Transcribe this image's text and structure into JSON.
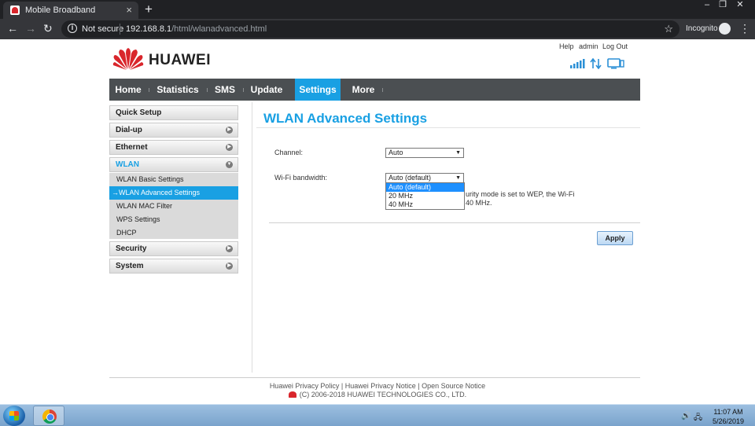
{
  "browser": {
    "tab_title": "Mobile Broadband",
    "tab_close": "×",
    "new_tab": "+",
    "not_secure": "Not secure",
    "url_host": "192.168.8.1",
    "url_path": "/html/wlanadvanced.html",
    "incognito": "Incognito",
    "win_minimize": "‒",
    "win_restore": "❐",
    "win_close": "✕"
  },
  "header": {
    "brand": "HUAWEI",
    "links": [
      "Help",
      "admin",
      "Log Out"
    ]
  },
  "nav": {
    "items": [
      "Home",
      "Statistics",
      "SMS",
      "Update",
      "Settings",
      "More"
    ],
    "active": "Settings"
  },
  "sidebar": {
    "quick_setup": "Quick Setup",
    "dialup": "Dial-up",
    "ethernet": "Ethernet",
    "wlan": "WLAN",
    "wlan_sub": [
      "WLAN Basic Settings",
      "WLAN Advanced Settings",
      "WLAN MAC Filter",
      "WPS Settings",
      "DHCP"
    ],
    "active_sub_prefix": "→",
    "security": "Security",
    "system": "System"
  },
  "content": {
    "title": "WLAN Advanced Settings",
    "channel_label": "Channel:",
    "channel_value": "Auto",
    "bandwidth_label": "Wi-Fi bandwidth:",
    "bandwidth_value": "Auto (default)",
    "bandwidth_options": [
      "Auto (default)",
      "20 MHz",
      "40 MHz"
    ],
    "note_line1": "urity mode is set to WEP, the Wi-Fi",
    "note_line2": "40 MHz.",
    "apply": "Apply"
  },
  "footer": {
    "privacy_policy": "Huawei Privacy Policy",
    "privacy_notice": "Huawei Privacy Notice",
    "open_source": "Open Source Notice",
    "divider": "|",
    "copyright": "(C) 2006-2018 HUAWEI TECHNOLOGIES CO., LTD."
  },
  "taskbar": {
    "time": "11:07 AM",
    "date": "5/26/2019"
  }
}
